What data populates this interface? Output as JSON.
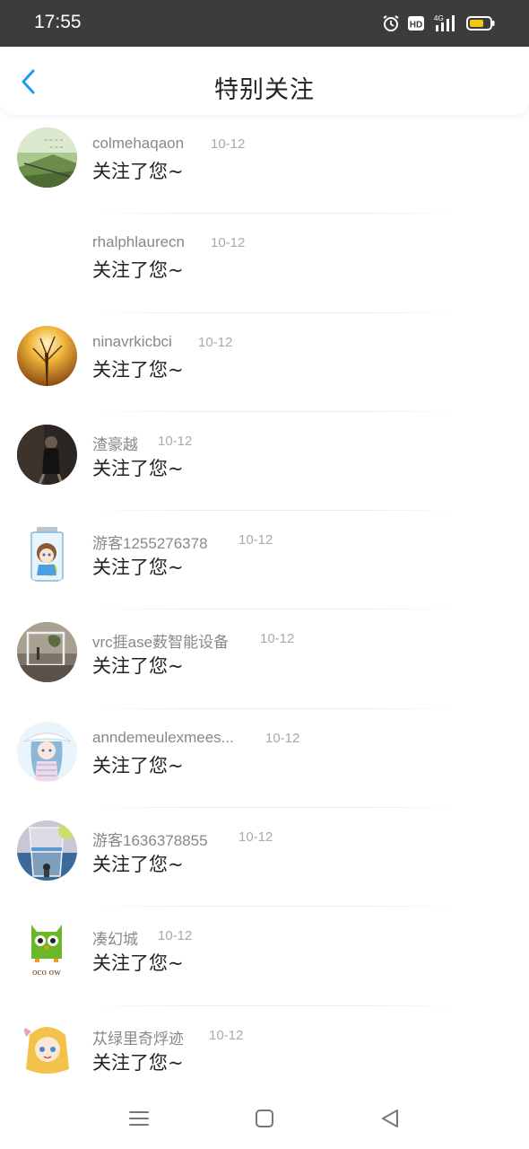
{
  "status_bar": {
    "time": "17:55",
    "icons": [
      "alarm-icon",
      "hd-icon",
      "4g-signal-icon",
      "battery-icon"
    ],
    "hd_label": "HD",
    "network_label": "4G"
  },
  "header": {
    "title": "特别关注",
    "back_icon": "chevron-left-icon",
    "accent_color": "#1e9bf0"
  },
  "items": [
    {
      "name": "colmehaqaon",
      "date": "10-12",
      "message": "关注了您~",
      "avatar": "scenery-text"
    },
    {
      "name": "rhalphlaurecn",
      "date": "10-12",
      "message": "关注了您~",
      "avatar": "none"
    },
    {
      "name": "ninavrkicbci",
      "date": "10-12",
      "message": "关注了您~",
      "avatar": "autumn-tree"
    },
    {
      "name": "渣豪越",
      "date": "10-12",
      "message": "关注了您~",
      "avatar": "dark-figure"
    },
    {
      "name": "游客1255276378",
      "date": "10-12",
      "message": "关注了您~",
      "avatar": "jar-girl"
    },
    {
      "name": "vrc捱ase薮智能设备",
      "date": "10-12",
      "message": "关注了您~",
      "avatar": "photo-frame"
    },
    {
      "name": "anndemeulexmees...",
      "date": "10-12",
      "message": "关注了您~",
      "avatar": "anime-girl-hat"
    },
    {
      "name": "游客1636378855",
      "date": "10-12",
      "message": "关注了您~",
      "avatar": "glass-sea"
    },
    {
      "name": "凑幻城",
      "date": "10-12",
      "message": "关注了您~",
      "avatar": "owl-logo"
    },
    {
      "name": "苁绿里奇烰迹",
      "date": "10-12",
      "message": "关注了您~",
      "avatar": "blonde-girl"
    }
  ],
  "owl_logo_text": "oco ow",
  "nav_bar": {
    "icons": [
      "menu-icon",
      "home-icon",
      "back-triangle-icon"
    ]
  }
}
